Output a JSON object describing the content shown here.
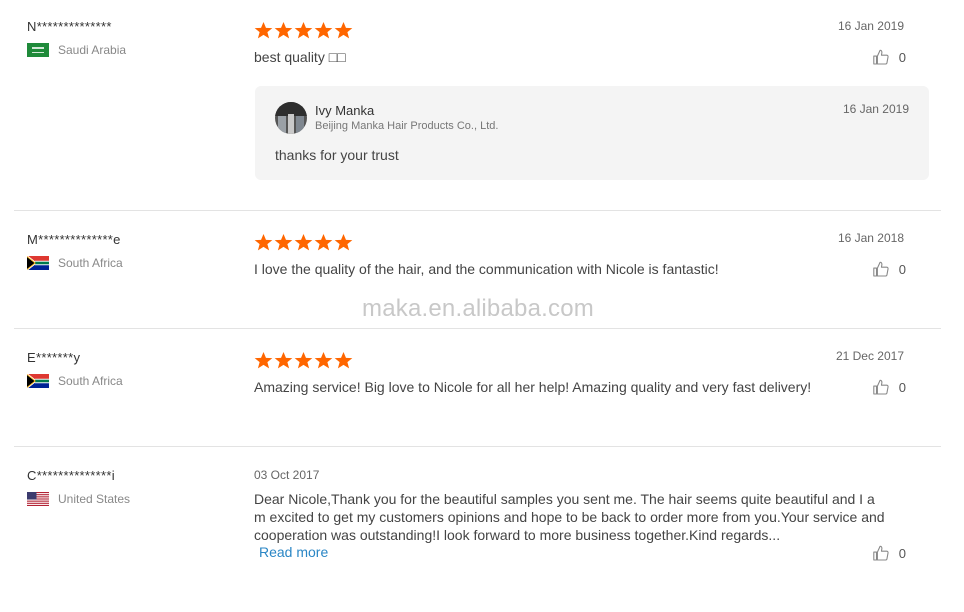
{
  "reviews": [
    {
      "user": "N**************",
      "country": "Saudi Arabia",
      "flag": "saudi-arabia",
      "rating": 5,
      "date": "16 Jan 2019",
      "text": "best quality □□",
      "likes": "0",
      "reply": {
        "name": "Ivy Manka",
        "company": "Beijing Manka Hair Products Co., Ltd.",
        "date": "16 Jan 2019",
        "text": "thanks for your trust"
      }
    },
    {
      "user": "M**************e",
      "country": "South Africa",
      "flag": "south-africa",
      "rating": 5,
      "date": "16 Jan 2018",
      "text": "I love the quality of the hair, and the communication with Nicole is fantastic!",
      "likes": "0"
    },
    {
      "user": "E*******y",
      "country": "South Africa",
      "flag": "south-africa",
      "rating": 5,
      "date": "21 Dec 2017",
      "text": "Amazing service! Big love to Nicole for all her help! Amazing quality and very fast delivery!",
      "likes": "0"
    },
    {
      "user": "C**************i",
      "country": "United States",
      "flag": "united-states",
      "date": "03 Oct 2017",
      "text_lines": [
        "Dear Nicole,Thank you for the beautiful samples you sent me.  The hair seems quite beautiful and I a",
        "m excited to get my customers opinions and hope to be back to order more from you.Your service and",
        "cooperation was outstanding!I look forward to more business together.Kind regards..."
      ],
      "read_more": "Read more",
      "likes": "0"
    }
  ],
  "watermark": "maka.en.alibaba.com",
  "colors": {
    "star": "#ff6600",
    "link": "#2a86c5"
  }
}
